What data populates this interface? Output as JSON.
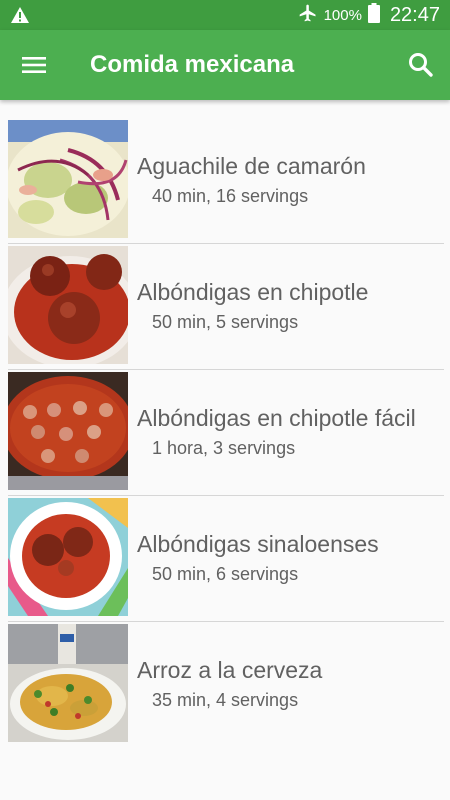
{
  "status_bar": {
    "battery_percent": "100%",
    "time": "22:47"
  },
  "app_bar": {
    "title": "Comida mexicana"
  },
  "recipes": [
    {
      "name": "Aguachile de camarón",
      "meta": "40 min, 16 servings"
    },
    {
      "name": "Albóndigas en chipotle",
      "meta": "50 min, 5 servings"
    },
    {
      "name": "Albóndigas en chipotle fácil",
      "meta": "1 hora, 3 servings"
    },
    {
      "name": "Albóndigas sinaloenses",
      "meta": "50 min, 6 servings"
    },
    {
      "name": "Arroz a la cerveza",
      "meta": "35 min, 4 servings"
    }
  ],
  "colors": {
    "app_bar": "#4caf50",
    "status_bar": "#3f9d40",
    "text": "#616161"
  }
}
